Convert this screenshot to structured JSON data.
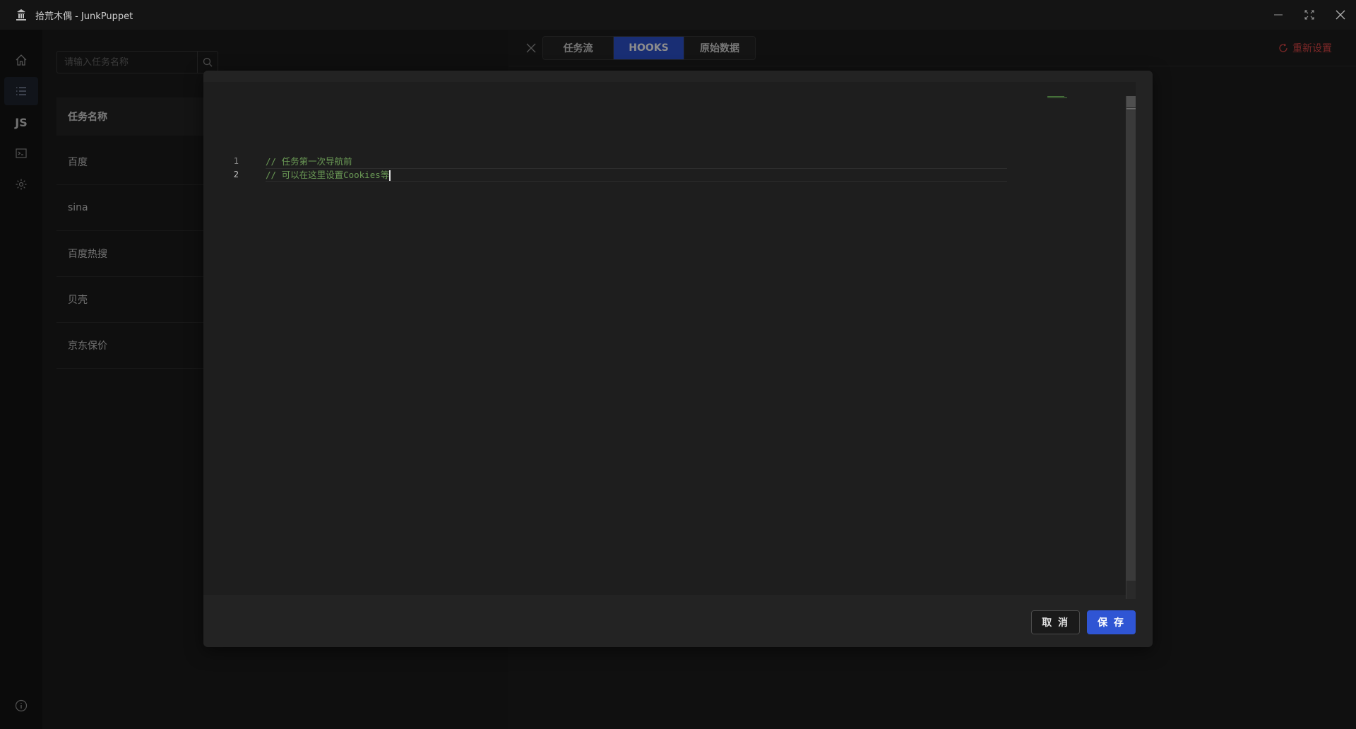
{
  "app": {
    "title": "拾荒木偶 - JunkPuppet"
  },
  "sidebar": {
    "items": [
      {
        "name": "home-icon"
      },
      {
        "name": "list-icon"
      },
      {
        "name": "js-icon",
        "label": "JS"
      },
      {
        "name": "terminal-icon"
      },
      {
        "name": "gear-icon"
      }
    ],
    "bottom": {
      "name": "info-icon"
    }
  },
  "task_panel": {
    "search_placeholder": "请输入任务名称",
    "column_header": "任务名称",
    "rows": [
      "百度",
      "sina",
      "百度热搜",
      "贝壳",
      "京东保价"
    ]
  },
  "detail": {
    "tabs": [
      {
        "label": "任务流",
        "active": false
      },
      {
        "label": "HOOKS",
        "active": true
      },
      {
        "label": "原始数据",
        "active": false
      }
    ],
    "reset_label": "重新设置"
  },
  "editor": {
    "lines": [
      {
        "num": "1",
        "text": "// 任务第一次导航前"
      },
      {
        "num": "2",
        "text": "// 可以在这里设置Cookies等"
      }
    ],
    "current_line": 2
  },
  "modal": {
    "cancel_label": "取 消",
    "save_label": "保 存"
  },
  "colors": {
    "accent": "#2f55d4",
    "danger": "#e04848",
    "comment": "#6a9955"
  }
}
